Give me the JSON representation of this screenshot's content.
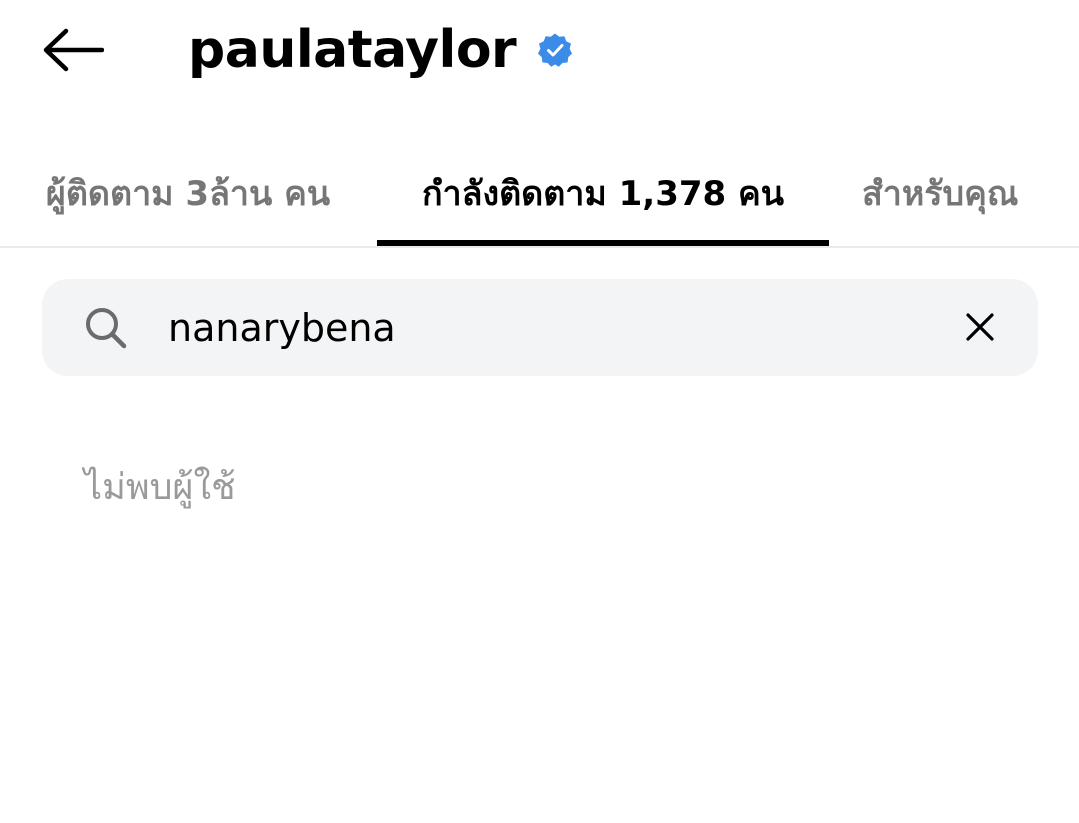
{
  "header": {
    "title": "paulataylor",
    "back_icon": "arrow-left-icon",
    "verified_icon": "verified-badge-icon",
    "verified_color": "#3b8ce8"
  },
  "tabs": [
    {
      "label": "ผู้ติดตาม 3ล้าน คน",
      "active": false
    },
    {
      "label": "กำลังติดตาม 1,378 คน",
      "active": true
    },
    {
      "label": "สำหรับคุณ",
      "active": false
    }
  ],
  "search": {
    "value": "nanarybena",
    "search_icon": "search-icon",
    "clear_icon": "close-icon"
  },
  "results": {
    "empty_message": "ไม่พบผู้ใช้"
  }
}
